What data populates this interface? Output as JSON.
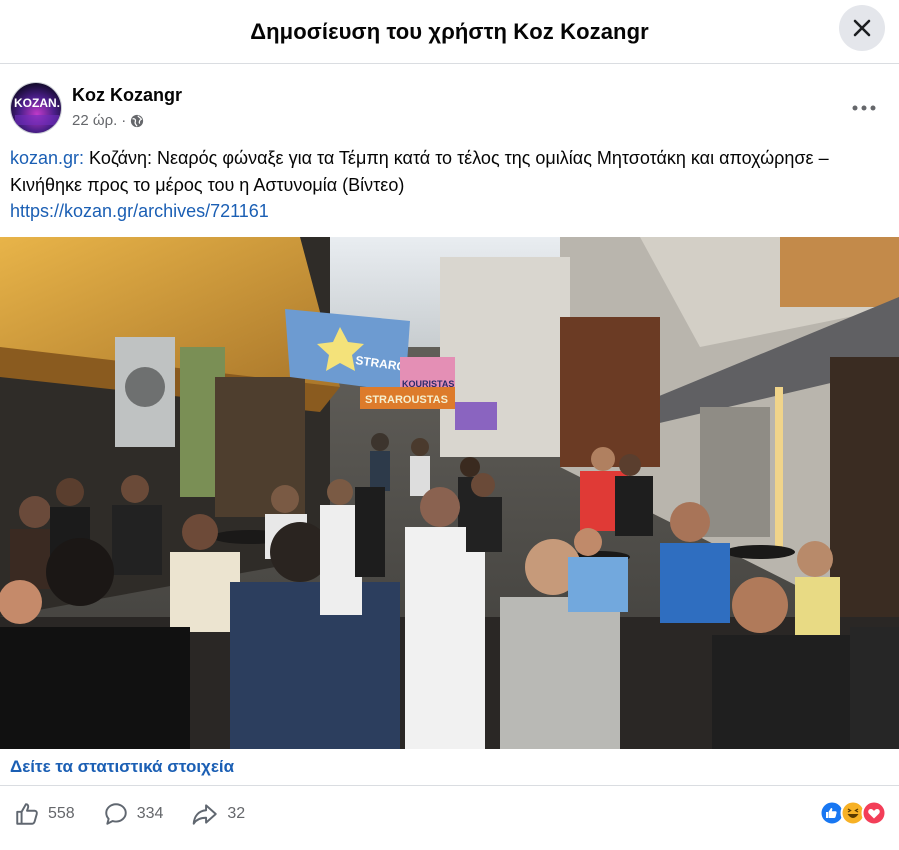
{
  "header": {
    "title": "Δημοσίευση του χρήστη Koz Kozangr",
    "close_icon": "close-icon"
  },
  "post": {
    "author": "Koz Kozangr",
    "avatar_text": "KOZAN.",
    "time": "22 ώρ.",
    "meta_separator": "·",
    "privacy_icon": "globe-icon",
    "source": "kozan.gr:",
    "text": " Κοζάνη: Νεαρός φώναξε για τα Τέμπη κατά το τέλος της ομιλίας Μητσοτάκη και αποχώρησε – Κινήθηκε προς το μέρος του η Αστυνομία (Βίντεο)",
    "url": "https://kozan.gr/archives/721161",
    "photo_banners": [
      "STRAROUSTAS",
      "KOURISTAS",
      "STRAROUSTAS"
    ]
  },
  "stats_link": "Δείτε τα στατιστικά στοιχεία",
  "actions": {
    "likes": "558",
    "comments": "334",
    "shares": "32"
  },
  "reactions": [
    "like",
    "haha",
    "love"
  ],
  "colors": {
    "link": "#1b5fb4",
    "muted": "#65676b",
    "like_blue": "#1877f2",
    "love_red": "#f33e58",
    "haha_yellow": "#f7b125"
  }
}
